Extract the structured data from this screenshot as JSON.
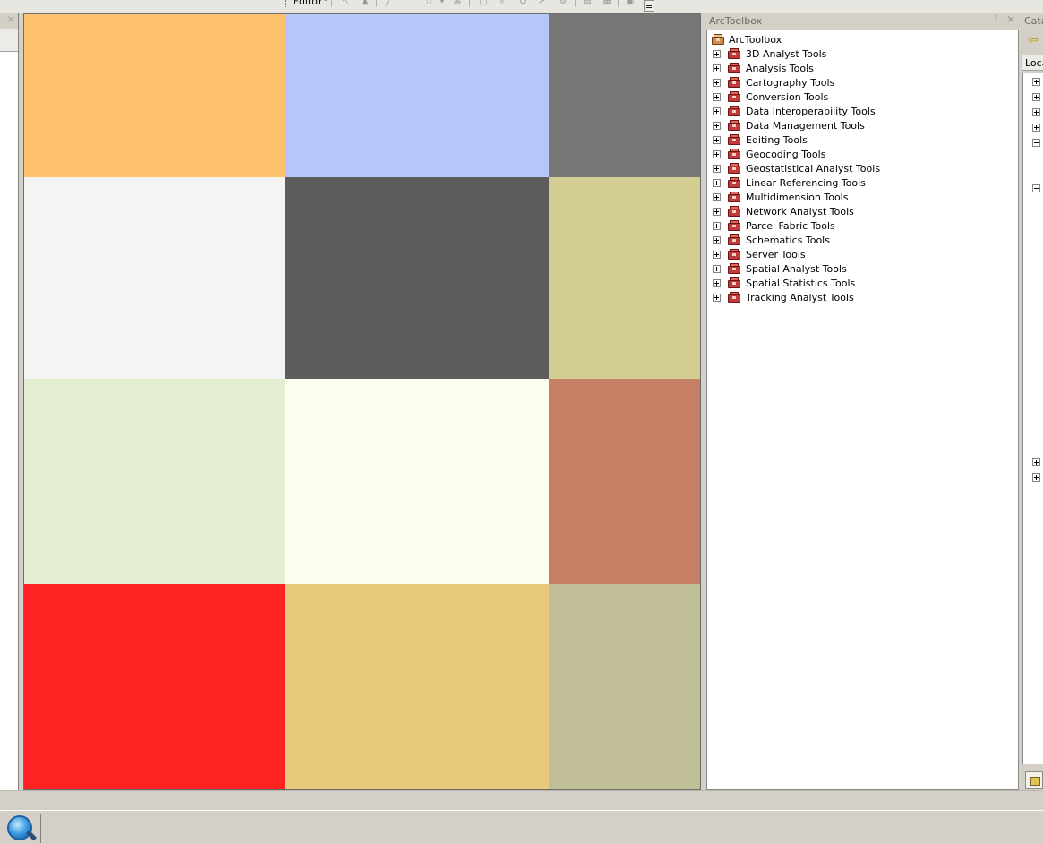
{
  "toolbar": {
    "editor_label": "Editor",
    "tool_icons": [
      "edit-tool-icon",
      "edit-annotation-icon",
      "straight-segment-icon",
      "endpoint-arc-icon",
      "trace-icon",
      "vertex-icon",
      "cut-polygons-icon",
      "split-icon",
      "reshape-icon",
      "rotate-icon",
      "attributes-icon",
      "sketch-properties-icon",
      "create-features-icon"
    ]
  },
  "map": {
    "grid_colors": [
      [
        "#fec16c",
        "#b6c6f9",
        "#777777"
      ],
      [
        "#f4f5f3",
        "#5d5d5d",
        "#d3cd94"
      ],
      [
        "#e3efd0",
        "#fdfeee",
        "#c47f65"
      ],
      [
        "#ff2222",
        "#e9ca7c",
        "#c0bf97"
      ]
    ]
  },
  "toolbox": {
    "title": "ArcToolbox",
    "root_label": "ArcToolbox",
    "items": [
      "3D Analyst Tools",
      "Analysis Tools",
      "Cartography Tools",
      "Conversion Tools",
      "Data Interoperability Tools",
      "Data Management Tools",
      "Editing Tools",
      "Geocoding Tools",
      "Geostatistical Analyst Tools",
      "Linear Referencing Tools",
      "Multidimension Tools",
      "Network Analyst Tools",
      "Parcel Fabric Tools",
      "Schematics Tools",
      "Server Tools",
      "Spatial Analyst Tools",
      "Spatial Statistics Tools",
      "Tracking Analyst Tools"
    ],
    "colors": {
      "toolbox_red": "#c0393b",
      "root_tan": "#d28b50"
    }
  },
  "catalog": {
    "title": "Cata",
    "location_label": "Loca",
    "expanders": [
      "plus",
      "plus",
      "plus",
      "plus",
      "minus",
      "minus",
      "plus",
      "plus"
    ]
  }
}
